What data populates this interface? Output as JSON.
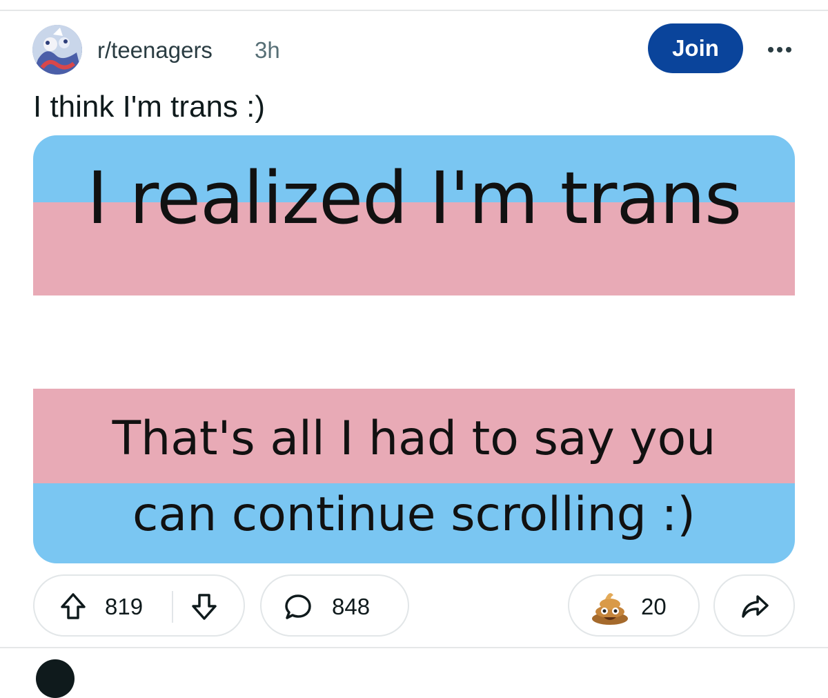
{
  "post": {
    "subreddit": "r/teenagers",
    "time_ago": "3h",
    "join_label": "Join",
    "title": "I think I'm trans :)"
  },
  "image": {
    "top_text": "I realized I'm trans",
    "bottom_text_line1": "That's all I had to say you",
    "bottom_text_line2": "can continue scrolling :)",
    "stripe_colors": [
      "#7ac6f2",
      "#e8aab6",
      "#ffffff",
      "#e8aab6",
      "#7ac6f2"
    ]
  },
  "actions": {
    "upvotes": "819",
    "comments": "848",
    "awards": "20",
    "icons": [
      "upvote-arrow",
      "downvote-arrow",
      "comment-bubble",
      "poop-award",
      "share-arrow"
    ]
  },
  "colors": {
    "join_bg": "#0a449b",
    "text_primary": "#0f1a1c",
    "text_secondary": "#576f76"
  }
}
